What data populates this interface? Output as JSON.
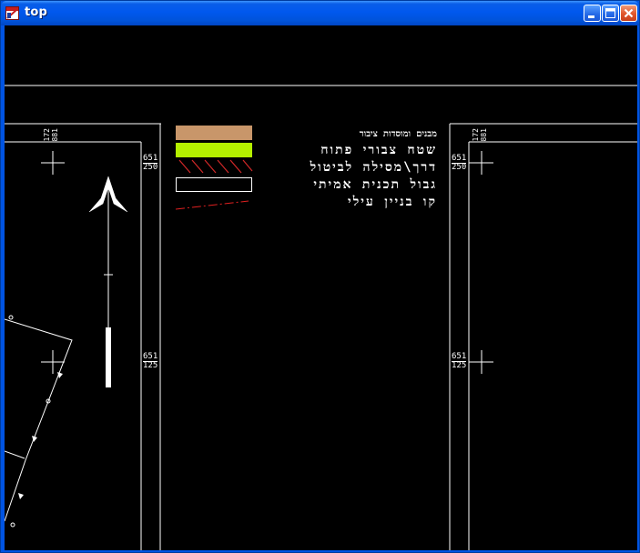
{
  "window": {
    "title": "top",
    "app_icon": "cad-app-icon",
    "controls": [
      "minimize-icon",
      "maximize-icon",
      "close-icon"
    ]
  },
  "legend": {
    "items": [
      {
        "label": "מבנים ומוסדות ציבור",
        "swatch": "fill",
        "color": "#c8966a"
      },
      {
        "label": "שטח צבורי פתוח",
        "swatch": "fill",
        "color": "#b4f000"
      },
      {
        "label": "דרך\\מסילה לביטול",
        "swatch": "hatch",
        "color": "#d22828"
      },
      {
        "label": "גבול תכנית אמיתי",
        "swatch": "outline",
        "color": "#ffffff"
      },
      {
        "label": "קו בניין עילי",
        "swatch": "dashline",
        "color": "#e02020"
      }
    ]
  },
  "grid_labels": {
    "top_left_vertical": "172\n881",
    "top_right_vertical": "172\n881",
    "left_upper": [
      "651",
      "250"
    ],
    "left_lower": [
      "651",
      "125"
    ],
    "right_upper": [
      "651",
      "250"
    ],
    "right_lower": [
      "651",
      "125"
    ]
  },
  "colors": {
    "background": "#000000",
    "lines": "#ffffff",
    "titlebar": "#0058ee"
  }
}
